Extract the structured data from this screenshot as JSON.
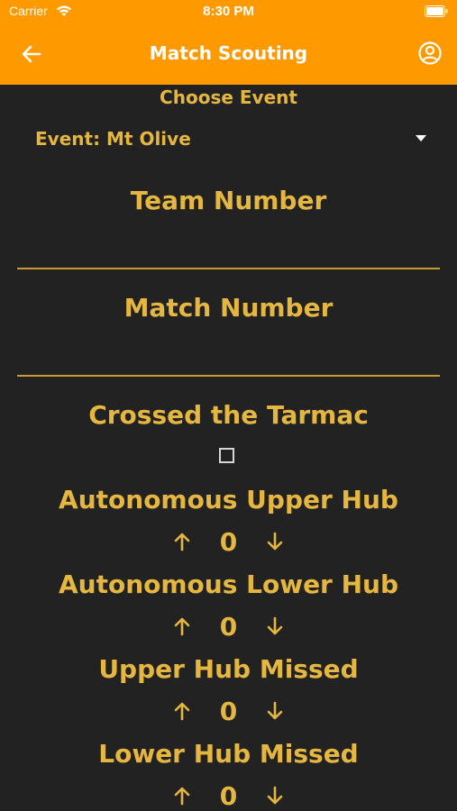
{
  "status_bar": {
    "carrier": "Carrier",
    "time": "8:30 PM"
  },
  "nav": {
    "title": "Match Scouting",
    "back_icon": "back-arrow-icon",
    "profile_icon": "account-circle-icon"
  },
  "event": {
    "choose_label": "Choose Event",
    "selected": "Event: Mt Olive"
  },
  "fields": {
    "team_number_label": "Team Number",
    "team_number_value": "",
    "match_number_label": "Match Number",
    "match_number_value": ""
  },
  "checkbox": {
    "label": "Crossed the Tarmac",
    "checked": false
  },
  "counters": [
    {
      "label": "Autonomous Upper Hub",
      "value": "0"
    },
    {
      "label": "Autonomous Lower Hub",
      "value": "0"
    },
    {
      "label": "Upper Hub Missed",
      "value": "0"
    },
    {
      "label": "Lower Hub Missed",
      "value": "0"
    }
  ],
  "colors": {
    "header": "#FF9900",
    "background": "#222222",
    "accent": "#E5B740"
  }
}
